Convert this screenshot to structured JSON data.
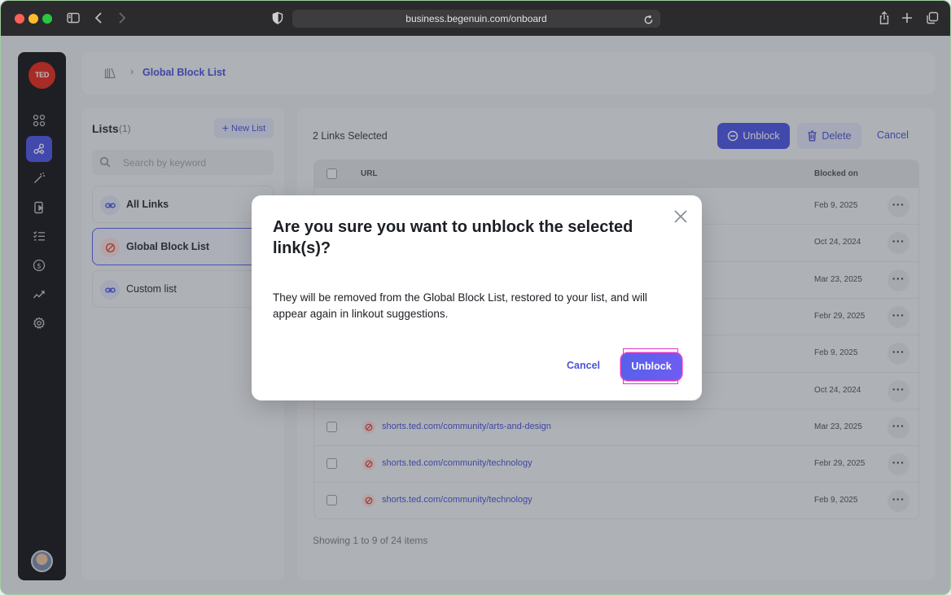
{
  "browser": {
    "url": "business.begenuin.com/onboard"
  },
  "app": {
    "logo_text": "TED"
  },
  "breadcrumb": {
    "current": "Global Block List"
  },
  "lists": {
    "title": "Lists",
    "count": "(1)",
    "new_list_label": "New List",
    "search_placeholder": "Search by keyword",
    "items": [
      {
        "label": "All Links"
      },
      {
        "label": "Global Block List"
      },
      {
        "label": "Custom list"
      }
    ]
  },
  "main": {
    "selected_text": "2 Links Selected",
    "unblock_label": "Unblock",
    "delete_label": "Delete",
    "cancel_label": "Cancel",
    "table": {
      "col_url": "URL",
      "col_blocked": "Blocked on",
      "rows": [
        {
          "url": "",
          "date": "Feb 9, 2025"
        },
        {
          "url": "",
          "date": "Oct 24, 2024"
        },
        {
          "url": "",
          "date": "Mar 23, 2025"
        },
        {
          "url": "",
          "date": "Febr 29, 2025"
        },
        {
          "url": "",
          "date": "Feb 9, 2025"
        },
        {
          "url": "",
          "date": "Oct 24, 2024"
        },
        {
          "url": "shorts.ted.com/community/arts-and-design",
          "date": "Mar 23, 2025"
        },
        {
          "url": "shorts.ted.com/community/technology",
          "date": "Febr 29, 2025"
        },
        {
          "url": "shorts.ted.com/community/technology",
          "date": "Feb 9, 2025"
        }
      ]
    },
    "showing": "Showing 1 to 9 of 24 items"
  },
  "modal": {
    "title": "Are you sure you want to unblock the selected link(s)?",
    "body": "They will be removed from the Global Block List, restored to your list, and will appear again in linkout suggestions.",
    "cancel_label": "Cancel",
    "confirm_label": "Unblock"
  },
  "colors": {
    "accent": "#4f57e6",
    "danger": "#e2443a",
    "highlight": "#e035c7"
  }
}
